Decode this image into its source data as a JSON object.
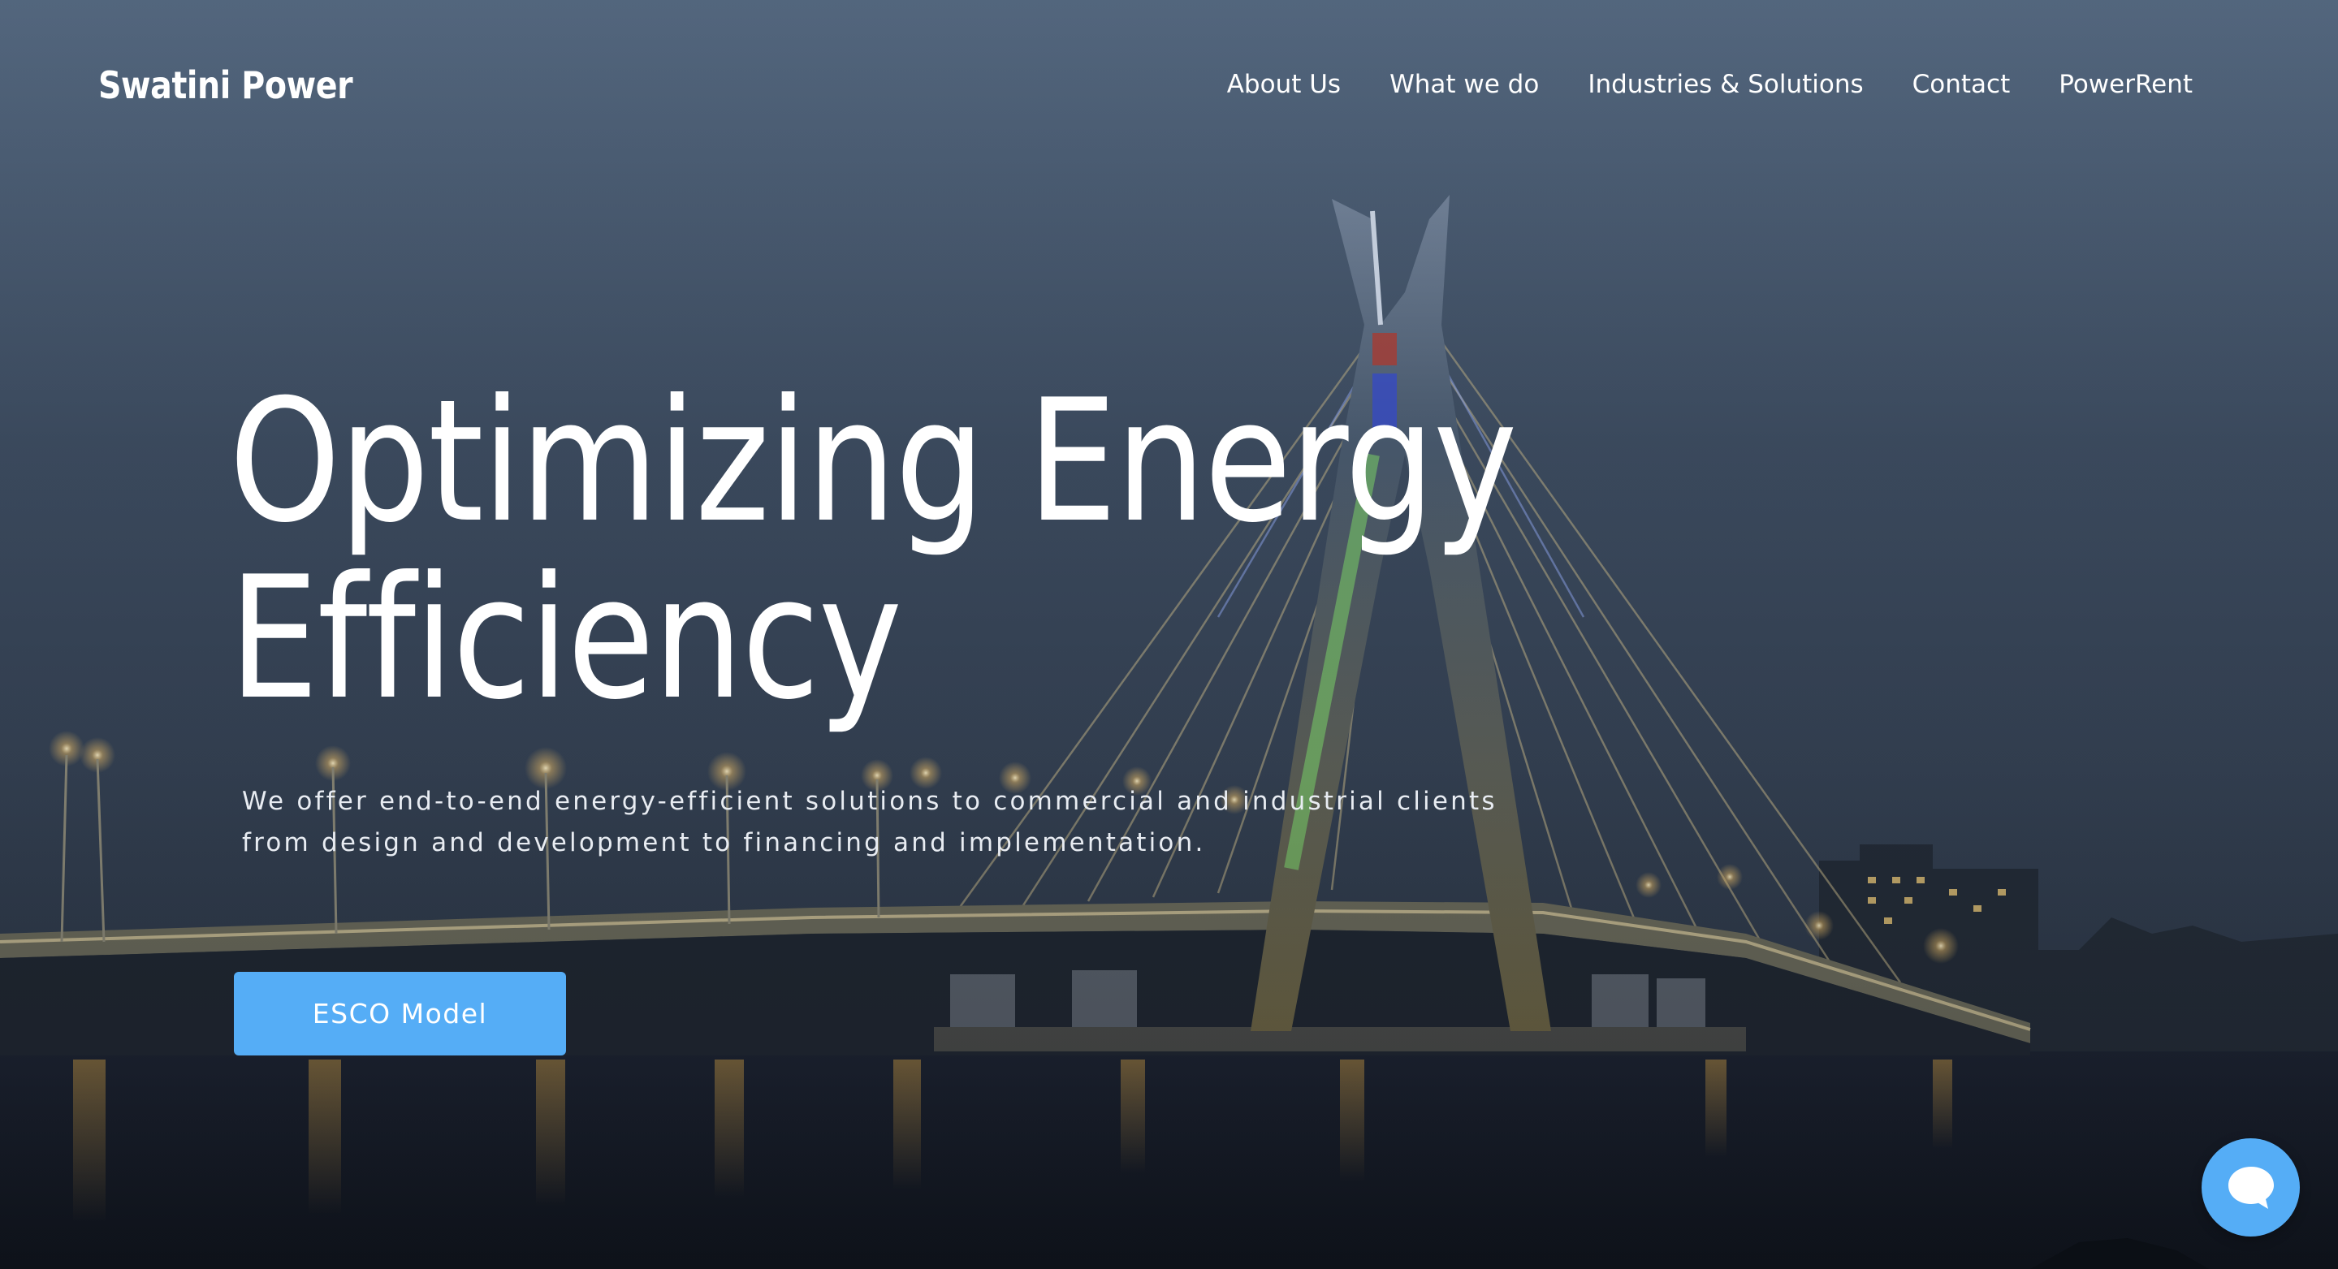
{
  "header": {
    "brand": "Swatini Power",
    "nav": [
      {
        "label": "About Us"
      },
      {
        "label": "What we do"
      },
      {
        "label": "Industries & Solutions"
      },
      {
        "label": "Contact"
      },
      {
        "label": "PowerRent"
      }
    ]
  },
  "hero": {
    "headline_line1": "Optimizing Energy",
    "headline_line2": "Efficiency",
    "subtext_line1": "We offer end-to-end energy-efficient solutions to commercial and industrial clients",
    "subtext_line2": "from design and development to financing and implementation.",
    "cta_label": "ESCO Model",
    "background_image": "night cable-stayed bridge over water"
  },
  "chat_widget": {
    "icon": "chat-bubble-icon"
  },
  "colors": {
    "accent": "#55adf6",
    "text": "#ffffff"
  }
}
